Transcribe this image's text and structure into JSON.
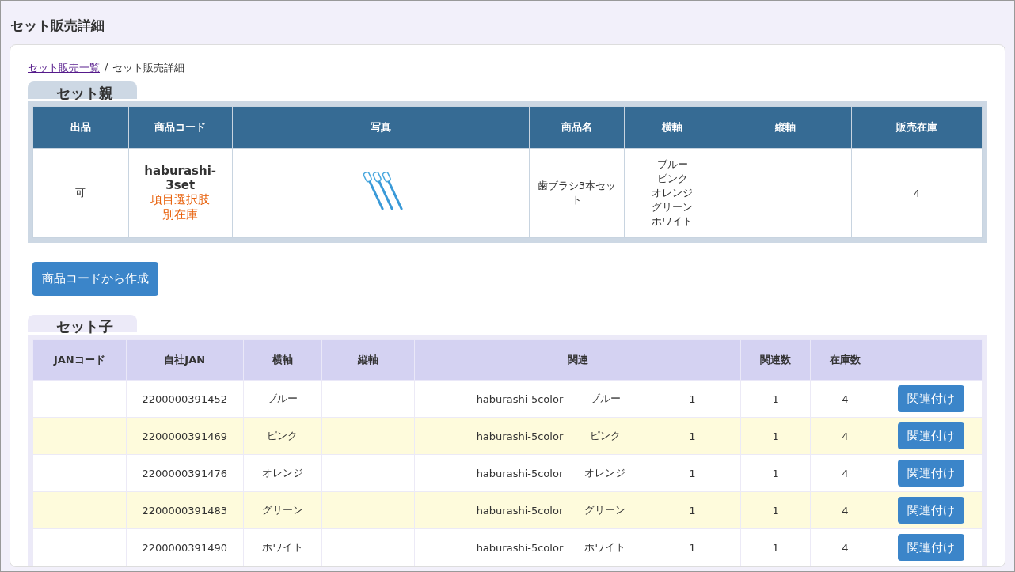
{
  "page": {
    "title": "セット販売詳細"
  },
  "breadcrumb": {
    "link": "セット販売一覧",
    "separator": "/",
    "current": "セット販売詳細"
  },
  "parent_section": {
    "tab": "セット親",
    "columns": [
      "出品",
      "商品コード",
      "写真",
      "商品名",
      "横軸",
      "縦軸",
      "販売在庫"
    ],
    "row": {
      "listed": "可",
      "product_code": "haburashi-3set",
      "notes": [
        "項目選択肢",
        "別在庫"
      ],
      "product_name": "歯ブラシ3本セット",
      "horizontal_axis": [
        "ブルー",
        "ピンク",
        "オレンジ",
        "グリーン",
        "ホワイト"
      ],
      "stock": "4"
    }
  },
  "create_button": "商品コードから作成",
  "child_section": {
    "tab": "セット子",
    "columns": [
      "JANコード",
      "自社JAN",
      "横軸",
      "縦軸",
      "関連",
      "関連数",
      "在庫数"
    ],
    "rows": [
      {
        "own_jan": "2200000391452",
        "horizontal_axis": "ブルー",
        "related_code": "haburashi-5color",
        "related_name": "ブルー",
        "related_qty": "1",
        "related_count": "1",
        "stock": "4",
        "button": "関連付け"
      },
      {
        "own_jan": "2200000391469",
        "horizontal_axis": "ピンク",
        "related_code": "haburashi-5color",
        "related_name": "ピンク",
        "related_qty": "1",
        "related_count": "1",
        "stock": "4",
        "button": "関連付け"
      },
      {
        "own_jan": "2200000391476",
        "horizontal_axis": "オレンジ",
        "related_code": "haburashi-5color",
        "related_name": "オレンジ",
        "related_qty": "1",
        "related_count": "1",
        "stock": "4",
        "button": "関連付け"
      },
      {
        "own_jan": "2200000391483",
        "horizontal_axis": "グリーン",
        "related_code": "haburashi-5color",
        "related_name": "グリーン",
        "related_qty": "1",
        "related_count": "1",
        "stock": "4",
        "button": "関連付け"
      },
      {
        "own_jan": "2200000391490",
        "horizontal_axis": "ホワイト",
        "related_code": "haburashi-5color",
        "related_name": "ホワイト",
        "related_qty": "1",
        "related_count": "1",
        "stock": "4",
        "button": "関連付け"
      }
    ]
  }
}
